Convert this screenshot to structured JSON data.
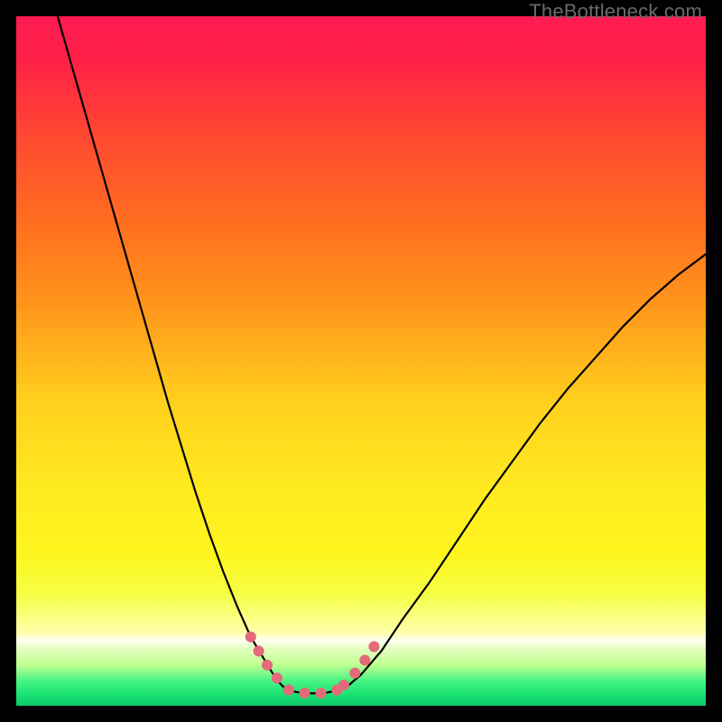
{
  "watermark": "TheBottleneck.com",
  "colors": {
    "frame": "#000000",
    "watermark_text": "#6a6a6a",
    "curve_black": "#000000",
    "pink_stroke": "#e4697b",
    "bottom_green": "#18e072"
  },
  "gradient_stops": [
    {
      "offset": 0.0,
      "color": "#ff1b51"
    },
    {
      "offset": 0.06,
      "color": "#ff2048"
    },
    {
      "offset": 0.18,
      "color": "#ff4a30"
    },
    {
      "offset": 0.3,
      "color": "#ff6e1f"
    },
    {
      "offset": 0.42,
      "color": "#ff961b"
    },
    {
      "offset": 0.56,
      "color": "#ffd01d"
    },
    {
      "offset": 0.68,
      "color": "#ffe920"
    },
    {
      "offset": 0.78,
      "color": "#fff51e"
    },
    {
      "offset": 0.84,
      "color": "#f5ff46"
    },
    {
      "offset": 0.895,
      "color": "#ffffae"
    },
    {
      "offset": 0.905,
      "color": "#fffff4"
    },
    {
      "offset": 0.915,
      "color": "#e7ffc6"
    },
    {
      "offset": 0.94,
      "color": "#c1ff90"
    },
    {
      "offset": 0.965,
      "color": "#43f483"
    },
    {
      "offset": 0.985,
      "color": "#18e072"
    },
    {
      "offset": 1.0,
      "color": "#0fc86b"
    }
  ],
  "chart_data": {
    "type": "line",
    "title": "",
    "xlabel": "",
    "ylabel": "",
    "xlim": [
      0,
      100
    ],
    "ylim": [
      0,
      100
    ],
    "series": [
      {
        "name": "left_branch",
        "x": [
          6,
          8,
          10,
          12,
          14,
          16,
          18,
          20,
          22,
          24,
          26,
          28,
          30,
          32,
          34,
          35.5,
          37,
          38,
          39
        ],
        "y": [
          100,
          93,
          86,
          79,
          72,
          65,
          58,
          51,
          44,
          37.5,
          31,
          25,
          19.5,
          14.5,
          10,
          7.5,
          5,
          3.5,
          2.5
        ]
      },
      {
        "name": "valley_floor",
        "x": [
          39,
          40.5,
          42,
          43.5,
          45,
          46.5,
          48
        ],
        "y": [
          2.5,
          2.0,
          1.8,
          1.8,
          1.9,
          2.2,
          2.8
        ]
      },
      {
        "name": "right_branch",
        "x": [
          48,
          50,
          53,
          56,
          60,
          64,
          68,
          72,
          76,
          80,
          84,
          88,
          92,
          96,
          100
        ],
        "y": [
          2.8,
          4.5,
          8,
          12.5,
          18,
          24,
          30,
          35.5,
          41,
          46,
          50.5,
          55,
          59,
          62.5,
          65.5
        ]
      },
      {
        "name": "pink_left_segment",
        "x": [
          34,
          35,
          36,
          37,
          38,
          39
        ],
        "y": [
          10,
          8.2,
          6.5,
          5,
          3.8,
          2.8
        ]
      },
      {
        "name": "pink_floor_segment",
        "x": [
          39.5,
          41,
          42.5,
          44,
          45.5,
          47
        ],
        "y": [
          2.3,
          1.9,
          1.8,
          1.8,
          2.0,
          2.4
        ]
      },
      {
        "name": "pink_right_segment",
        "x": [
          47.5,
          48.5,
          49.5,
          50.5,
          51.5,
          52.5
        ],
        "y": [
          3.0,
          4.0,
          5.2,
          6.5,
          8.0,
          9.5
        ]
      }
    ],
    "annotations": [
      {
        "text": "TheBottleneck.com",
        "position": "top-right"
      }
    ]
  }
}
